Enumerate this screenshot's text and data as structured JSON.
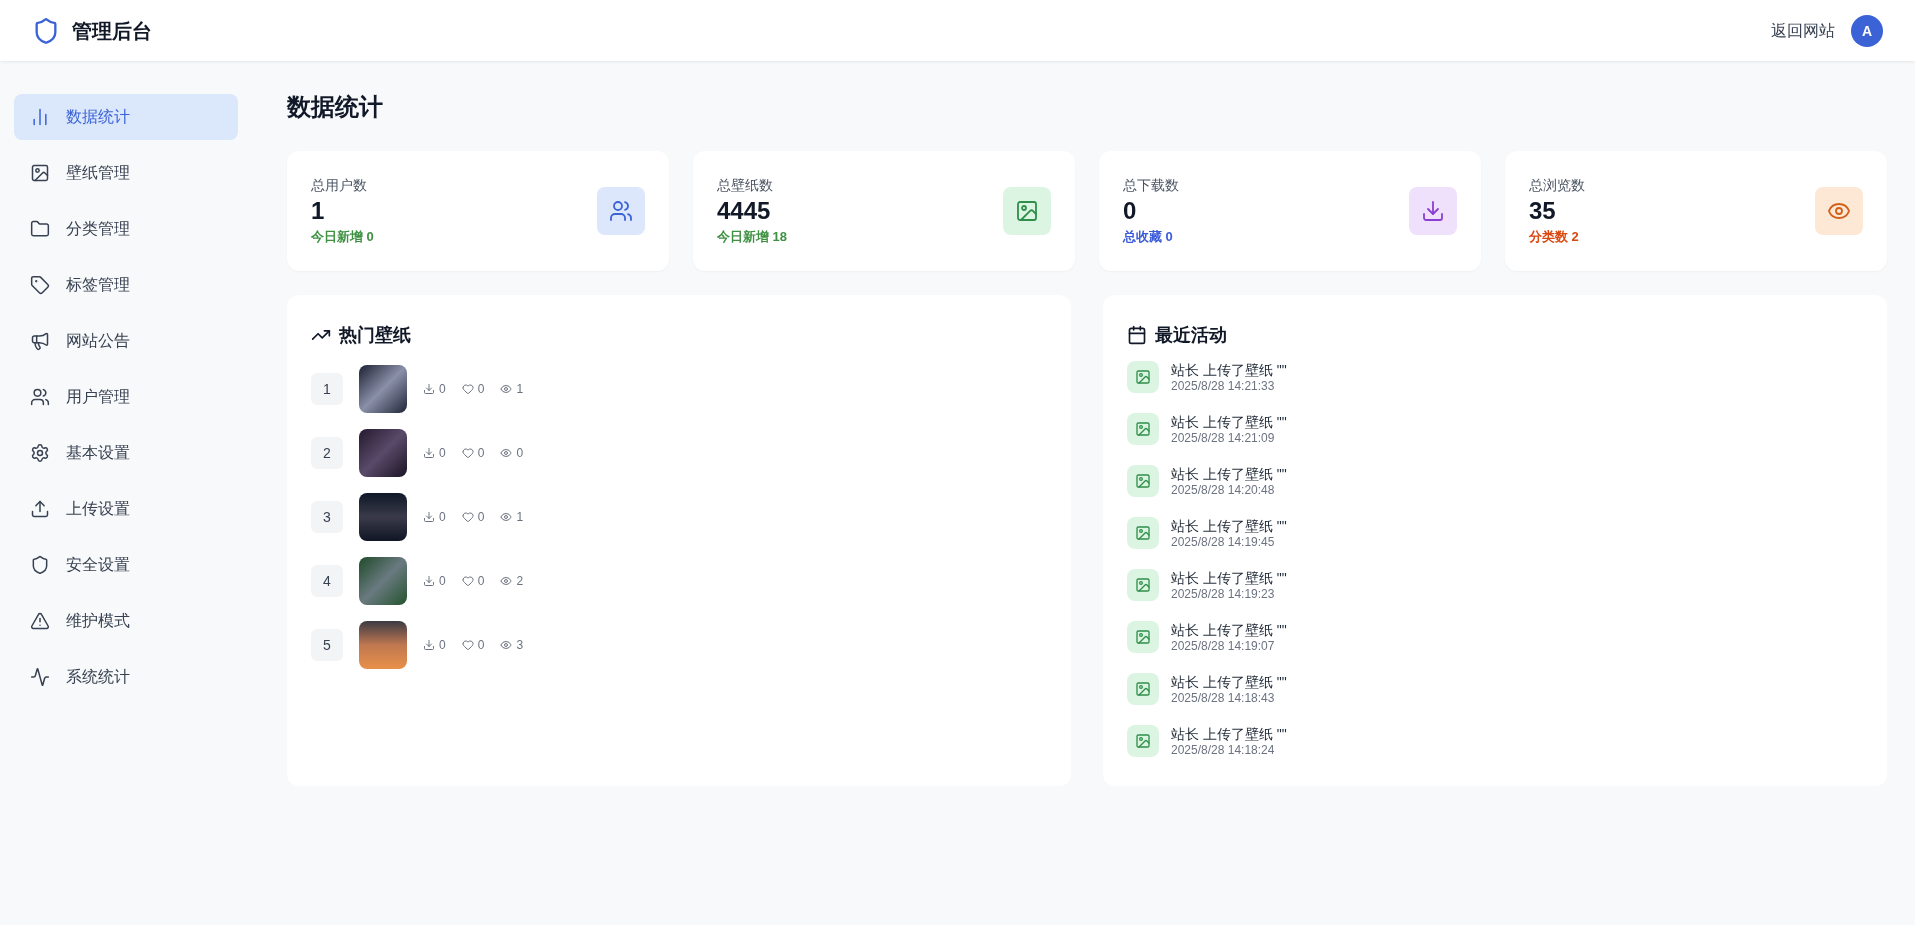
{
  "header": {
    "title": "管理后台",
    "back_link": "返回网站",
    "avatar": "A"
  },
  "sidebar": {
    "items": [
      {
        "label": "数据统计",
        "selected": true
      },
      {
        "label": "壁纸管理",
        "selected": false
      },
      {
        "label": "分类管理",
        "selected": false
      },
      {
        "label": "标签管理",
        "selected": false
      },
      {
        "label": "网站公告",
        "selected": false
      },
      {
        "label": "用户管理",
        "selected": false
      },
      {
        "label": "基本设置",
        "selected": false
      },
      {
        "label": "上传设置",
        "selected": false
      },
      {
        "label": "安全设置",
        "selected": false
      },
      {
        "label": "维护模式",
        "selected": false
      },
      {
        "label": "系统统计",
        "selected": false
      }
    ]
  },
  "page_title": "数据统计",
  "stats": [
    {
      "label": "总用户数",
      "value": "1",
      "sub": "今日新增 0",
      "color": "#3f9142"
    },
    {
      "label": "总壁纸数",
      "value": "4445",
      "sub": "今日新增 18",
      "color": "#3f9142"
    },
    {
      "label": "总下载数",
      "value": "0",
      "sub": "总收藏 0",
      "color": "#3b5bdb"
    },
    {
      "label": "总浏览数",
      "value": "35",
      "sub": "分类数 2",
      "color": "#d9480f"
    }
  ],
  "hot": {
    "title": "热门壁纸",
    "items": [
      {
        "rank": "1",
        "downloads": "0",
        "likes": "0",
        "views": "1"
      },
      {
        "rank": "2",
        "downloads": "0",
        "likes": "0",
        "views": "0"
      },
      {
        "rank": "3",
        "downloads": "0",
        "likes": "0",
        "views": "1"
      },
      {
        "rank": "4",
        "downloads": "0",
        "likes": "0",
        "views": "2"
      },
      {
        "rank": "5",
        "downloads": "0",
        "likes": "0",
        "views": "3"
      }
    ]
  },
  "activity": {
    "title": "最近活动",
    "items": [
      {
        "text": "站长 上传了壁纸 \"\"",
        "time": "2025/8/28 14:21:33"
      },
      {
        "text": "站长 上传了壁纸 \"\"",
        "time": "2025/8/28 14:21:09"
      },
      {
        "text": "站长 上传了壁纸 \"\"",
        "time": "2025/8/28 14:20:48"
      },
      {
        "text": "站长 上传了壁纸 \"\"",
        "time": "2025/8/28 14:19:45"
      },
      {
        "text": "站长 上传了壁纸 \"\"",
        "time": "2025/8/28 14:19:23"
      },
      {
        "text": "站长 上传了壁纸 \"\"",
        "time": "2025/8/28 14:19:07"
      },
      {
        "text": "站长 上传了壁纸 \"\"",
        "time": "2025/8/28 14:18:43"
      },
      {
        "text": "站长 上传了壁纸 \"\"",
        "time": "2025/8/28 14:18:24"
      }
    ]
  }
}
